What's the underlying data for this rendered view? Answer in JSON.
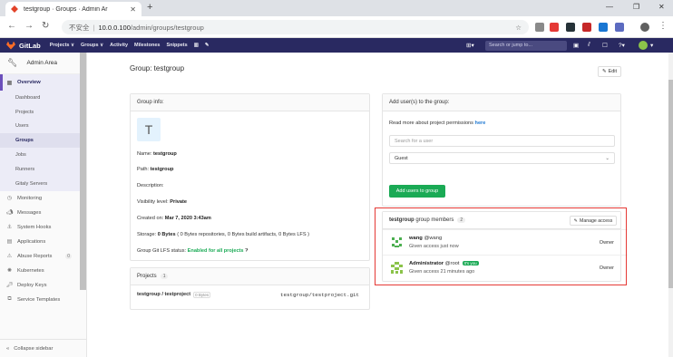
{
  "browser": {
    "tab_title": "testgroup · Groups · Admin Ar",
    "insecure_label": "不安全",
    "host": "10.0.0.100",
    "path": "/admin/groups/testgroup"
  },
  "gitlab_nav": {
    "brand": "GitLab",
    "menu": [
      "Projects ∨",
      "Groups ∨",
      "Activity",
      "Milestones",
      "Snippets"
    ],
    "search_placeholder": "Search or jump to..."
  },
  "sidebar": {
    "header": "Admin Area",
    "overview": "Overview",
    "overview_items": [
      "Dashboard",
      "Projects",
      "Users",
      "Groups",
      "Jobs",
      "Runners",
      "Gitaly Servers"
    ],
    "active_item": "Groups",
    "items": [
      {
        "label": "Monitoring",
        "icon": "monitoring-icon"
      },
      {
        "label": "Messages",
        "icon": "messages-icon"
      },
      {
        "label": "System Hooks",
        "icon": "hooks-icon"
      },
      {
        "label": "Applications",
        "icon": "applications-icon"
      },
      {
        "label": "Abuse Reports",
        "icon": "abuse-icon",
        "badge": "0"
      },
      {
        "label": "Kubernetes",
        "icon": "kubernetes-icon"
      },
      {
        "label": "Deploy Keys",
        "icon": "key-icon"
      },
      {
        "label": "Service Templates",
        "icon": "templates-icon"
      }
    ],
    "collapse": "Collapse sidebar"
  },
  "page": {
    "title": "Group: testgroup",
    "edit": "Edit"
  },
  "group_info": {
    "header": "Group info:",
    "avatar_letter": "T",
    "name_label": "Name:",
    "name_value": "testgroup",
    "path_label": "Path:",
    "path_value": "testgroup",
    "description_label": "Description:",
    "visibility_label": "Visibility level:",
    "visibility_value": "Private",
    "created_label": "Created on:",
    "created_value": "Mar 7, 2020 3:43am",
    "storage_label": "Storage:",
    "storage_value": "0 Bytes",
    "storage_detail": "( 0 Bytes repositories, 0 Bytes build artifacts, 0 Bytes LFS )",
    "lfs_label": "Group Git LFS status:",
    "lfs_value": "Enabled for all projects"
  },
  "projects": {
    "header": "Projects",
    "count": "1",
    "rows": [
      {
        "name": "testgroup / testproject",
        "size": "0 Bytes",
        "path": "testgroup/testproject.git"
      }
    ]
  },
  "add_users": {
    "header": "Add user(s) to the group:",
    "permissions_text": "Read more about project permissions",
    "permissions_link": "here",
    "search_placeholder": "Search for a user",
    "role_value": "Guest",
    "button": "Add users to group"
  },
  "members": {
    "group": "testgroup",
    "label": "group members",
    "count": "2",
    "manage": "Manage access",
    "rows": [
      {
        "name": "wang",
        "handle": "@wang",
        "access": "Given access just now",
        "role": "Owner",
        "you": ""
      },
      {
        "name": "Administrator",
        "handle": "@root",
        "access": "Given access 21 minutes ago",
        "role": "Owner",
        "you": "It's you"
      }
    ]
  },
  "colors": {
    "nav": "#292961",
    "accent_green": "#1aaa55",
    "highlight": "#e53935"
  }
}
